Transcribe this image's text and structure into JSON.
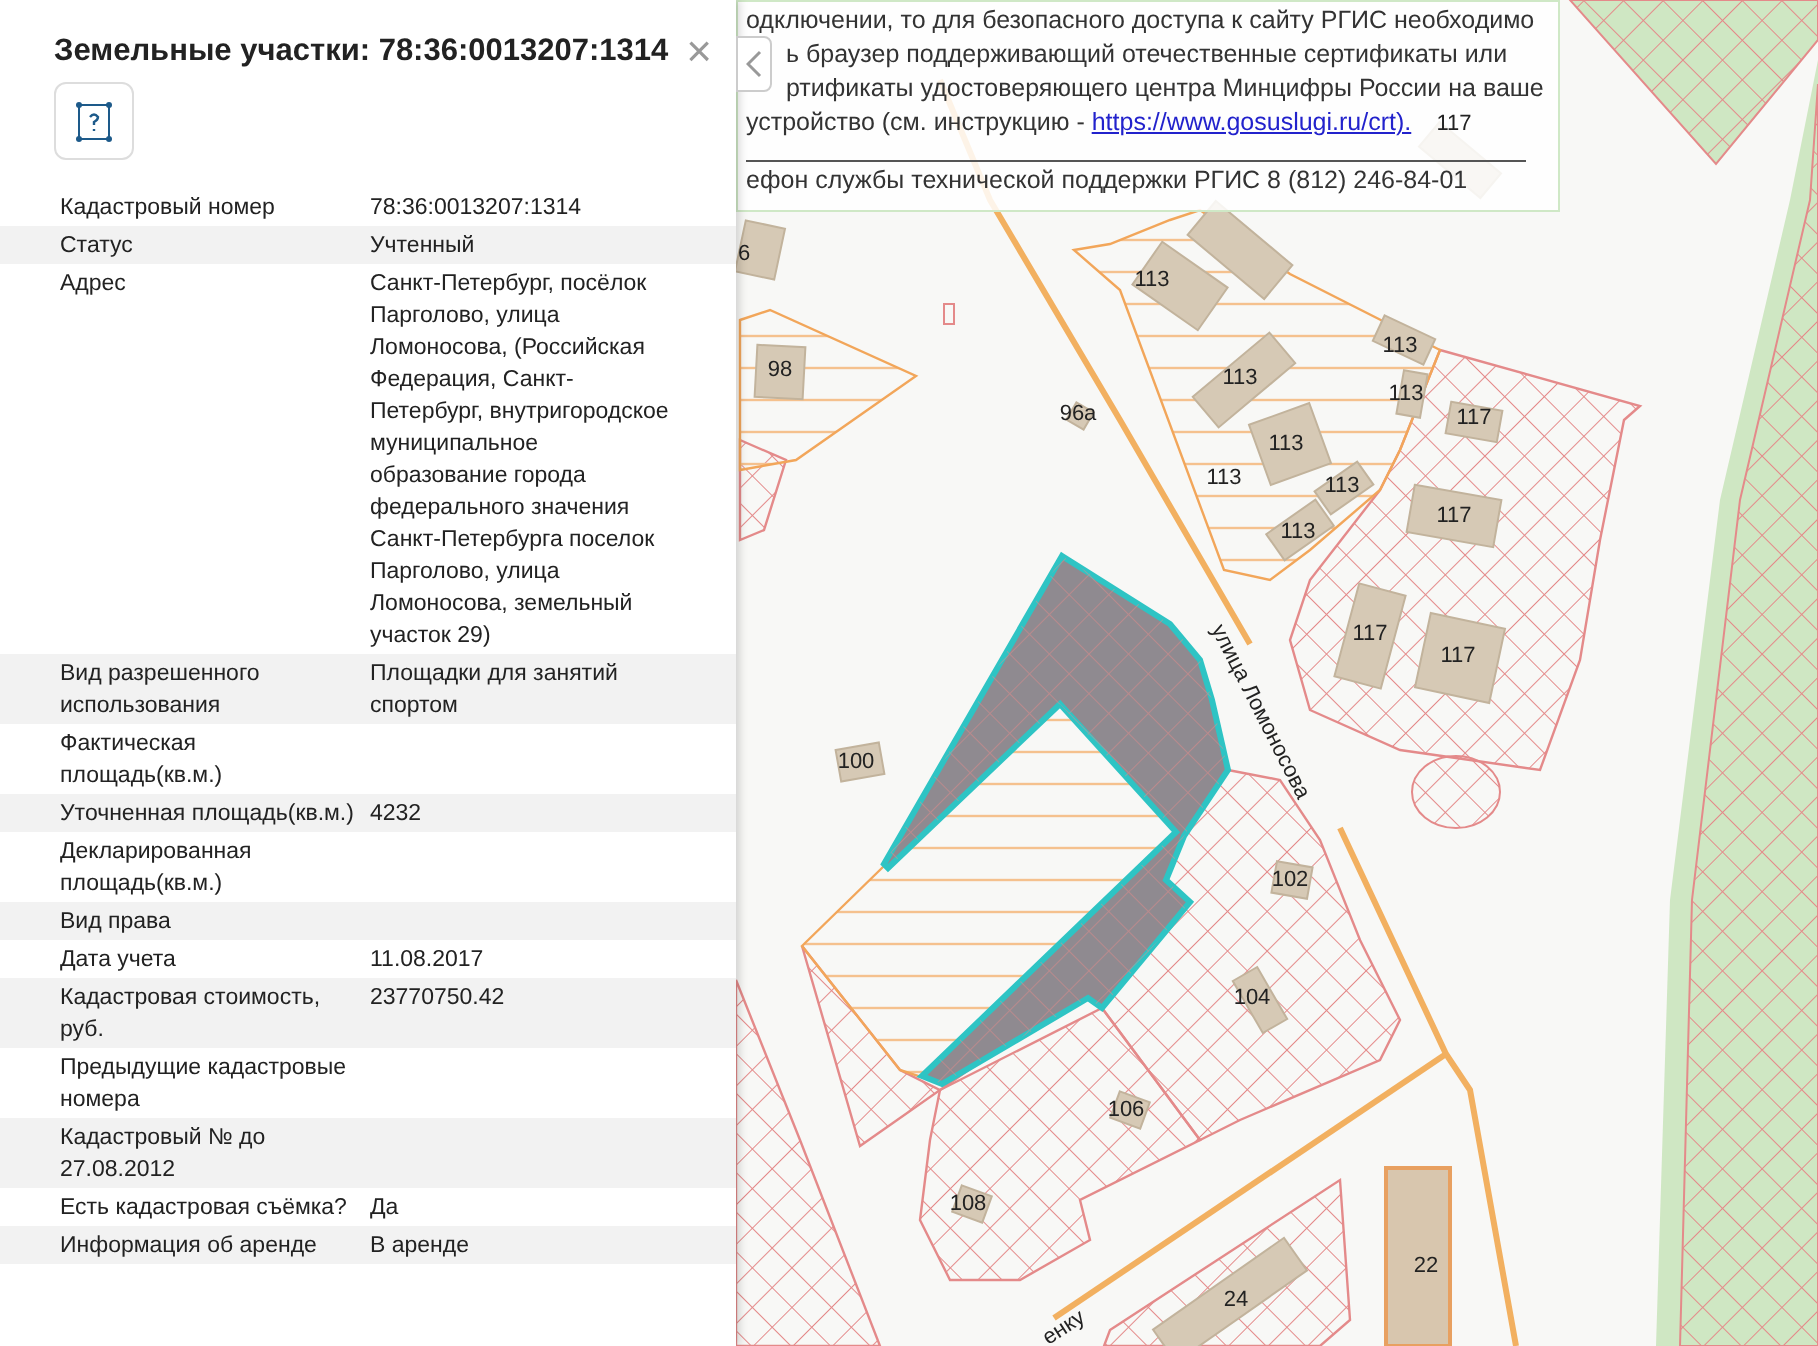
{
  "panel": {
    "title": "Земельные участки: 78:36:0013207:1314",
    "close": "×",
    "rows": [
      {
        "label": "Кадастровый номер",
        "value": "78:36:0013207:1314"
      },
      {
        "label": "Статус",
        "value": "Учтенный"
      },
      {
        "label": "Адрес",
        "value": "Санкт-Петербург, посёлок Парголово, улица Ломоносова, (Российская Федерация, Санкт-Петербург, внутригородское муниципальное образование города федерального значения Санкт-Петербурга поселок Парголово, улица Ломоносова, земельный участок 29)"
      },
      {
        "label": "Вид разрешенного использования",
        "value": "Площадки для занятий спортом"
      },
      {
        "label": "Фактическая площадь(кв.м.)",
        "value": ""
      },
      {
        "label": "Уточненная площадь(кв.м.)",
        "value": "4232"
      },
      {
        "label": "Декларированная площадь(кв.м.)",
        "value": ""
      },
      {
        "label": "Вид права",
        "value": ""
      },
      {
        "label": "Дата учета",
        "value": "11.08.2017"
      },
      {
        "label": "Кадастровая стоимость, руб.",
        "value": "23770750.42"
      },
      {
        "label": "Предыдущие кадастровые номера",
        "value": ""
      },
      {
        "label": "Кадастровый № до 27.08.2012",
        "value": ""
      },
      {
        "label": "Есть кадастровая съёмка?",
        "value": "Да"
      },
      {
        "label": "Информация об аренде",
        "value": "В аренде"
      }
    ]
  },
  "notice": {
    "lines": [
      {
        "text": "одключении, то для безопасного доступа к сайту РГИС необходимо"
      },
      {
        "text": "ь браузер поддерживающий отечественные сертификаты или"
      },
      {
        "text": "ртификаты удостоверяющего центра Минцифры России на ваше"
      },
      {
        "text": "устройство (см. инструкцию - ",
        "link": "https://www.gosuslugi.ru/crt)."
      },
      {
        "text": "ефон службы технической поддержки РГИС 8 (812) 246-84-01"
      }
    ]
  },
  "map": {
    "labels": [
      "117",
      "6",
      "113",
      "98",
      "96а",
      "113",
      "113",
      "113",
      "113",
      "113",
      "113",
      "113",
      "117",
      "117",
      "117",
      "117",
      "100",
      "102",
      "104",
      "106",
      "108",
      "24",
      "22"
    ],
    "streets": [
      "улица Ломоносова",
      "енку"
    ]
  }
}
